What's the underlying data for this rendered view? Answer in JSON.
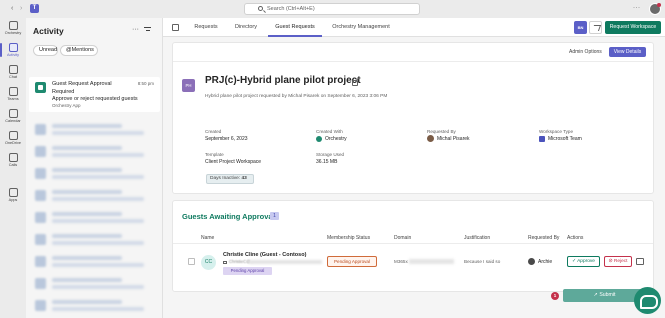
{
  "titlebar": {
    "search_placeholder": "Search (Ctrl+Alt+E)",
    "more": "···"
  },
  "rail": [
    {
      "label": "Orchestry"
    },
    {
      "label": "Activity"
    },
    {
      "label": "Chat"
    },
    {
      "label": "Teams"
    },
    {
      "label": "Calendar"
    },
    {
      "label": "OneDrive"
    },
    {
      "label": "Calls"
    },
    {
      "label": "Apps"
    }
  ],
  "activity": {
    "title": "Activity",
    "more": "···",
    "filters": [
      "Unread",
      "@Mentions"
    ],
    "notification": {
      "title": "Guest Request Approval",
      "time": "8:50 pm",
      "line2": "Required",
      "line3": "Approve or reject requested guests",
      "line4": "Orchestry App"
    }
  },
  "tabs": [
    "Requests",
    "Directory",
    "Guest Requests",
    "Orchestry Management"
  ],
  "toolbar": {
    "badge": "BN",
    "request_workspace": "Request Workspace"
  },
  "project": {
    "admin_options": "Admin Options",
    "view_details": "View Details",
    "badge": "PH",
    "title": "PRJ(c)-Hybrid plane pilot project",
    "subtitle": "Hybrid plane pilot project requested by Michal Pisarek on September 6, 2023 3:06 PM",
    "created_label": "Created",
    "created_value": "September 6, 2023",
    "created_with_label": "Created With",
    "created_with_value": "Orchestry",
    "requested_by_label": "Requested By",
    "requested_by_value": "Michal Pisarek",
    "workspace_type_label": "Workspace Type",
    "workspace_type_value": "Microsoft Team",
    "template_label": "Template",
    "template_value": "Client Project Workspace",
    "storage_label": "Storage Used",
    "storage_value": "36.15 MB",
    "days_inactive_label": "Days Inactive:",
    "days_inactive_value": "43"
  },
  "guests": {
    "title": "Guests Awaiting Approval",
    "count": "1",
    "headers": [
      "Name",
      "Membership Status",
      "Domain",
      "Justification",
      "Requested By",
      "Actions"
    ],
    "row": {
      "initials": "CC",
      "name": "Christie Cline (Guest - Contoso)",
      "email": "ChristieC@...",
      "tag": "Pending Approval",
      "status": "Pending Approval",
      "domain": "M365x",
      "justification": "Because I said so",
      "requested_by": "Archie",
      "approve": "Approve",
      "reject": "Reject"
    },
    "error_count": "1",
    "submit": "Submit"
  }
}
